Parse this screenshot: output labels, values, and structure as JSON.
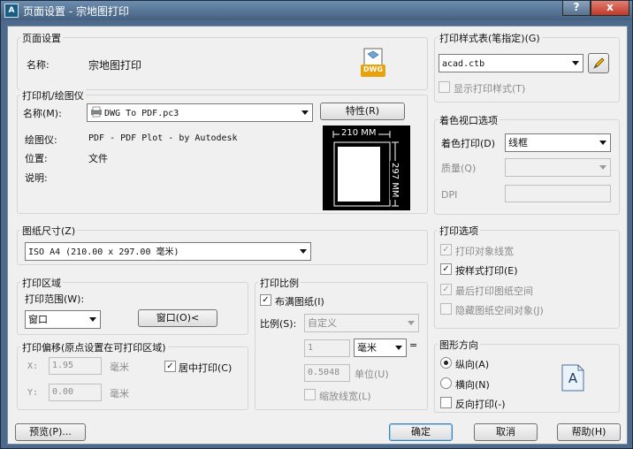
{
  "window": {
    "title": "页面设置 - 宗地图打印",
    "app_icon": "A",
    "help_label": "?",
    "close_label": "x"
  },
  "page_setup": {
    "group_label": "页面设置",
    "name_label": "名称:",
    "name_value": "宗地图打印",
    "dwg_icon_text": "DWG"
  },
  "printer": {
    "group_label": "打印机/绘图仪",
    "name_label": "名称(M):",
    "name_value": "DWG To PDF.pc3",
    "properties_button": "特性(R)",
    "plotter_label": "绘图仪:",
    "plotter_value": "PDF - PDF Plot - by Autodesk",
    "location_label": "位置:",
    "location_value": "文件",
    "description_label": "说明:",
    "preview_width_label": "210 MM",
    "preview_height_label": "297 MM"
  },
  "paper_size": {
    "group_label": "图纸尺寸(Z)",
    "value": "ISO A4 (210.00 x 297.00 毫米)"
  },
  "plot_area": {
    "group_label": "打印区域",
    "range_label": "打印范围(W):",
    "range_value": "窗口",
    "window_button": "窗口(O)<"
  },
  "plot_offset": {
    "group_label": "打印偏移(原点设置在可打印区域)",
    "x_label": "X:",
    "x_value": "1.95",
    "x_unit": "毫米",
    "y_label": "Y:",
    "y_value": "0.00",
    "y_unit": "毫米",
    "center_label": "居中打印(C)",
    "center_checked": true
  },
  "plot_scale": {
    "group_label": "打印比例",
    "fit_label": "布满图纸(I)",
    "fit_checked": true,
    "scale_label": "比例(S):",
    "scale_value": "自定义",
    "value1": "1",
    "unit_value": "毫米",
    "equals": "=",
    "value2": "0.5048",
    "unit2_label": "单位(U)",
    "scale_lineweights_label": "缩放线宽(L)"
  },
  "plot_style_table": {
    "group_label": "打印样式表(笔指定)(G)",
    "value": "acad.ctb",
    "display_label": "显示打印样式(T)",
    "display_checked": false
  },
  "shaded_viewport": {
    "group_label": "着色视口选项",
    "shade_label": "着色打印(D)",
    "shade_value": "线框",
    "quality_label": "质量(Q)",
    "dpi_label": "DPI"
  },
  "plot_options": {
    "group_label": "打印选项",
    "items": [
      {
        "label": "打印对象线宽",
        "checked": true,
        "enabled": false
      },
      {
        "label": "按样式打印(E)",
        "checked": true,
        "enabled": true
      },
      {
        "label": "最后打印图纸空间",
        "checked": true,
        "enabled": false
      },
      {
        "label": "隐藏图纸空间对象(J)",
        "checked": false,
        "enabled": false
      }
    ]
  },
  "orientation": {
    "group_label": "图形方向",
    "portrait_label": "纵向(A)",
    "landscape_label": "横向(N)",
    "upside_down_label": "反向打印(-)",
    "selected": "portrait",
    "icon_letter": "A"
  },
  "footer": {
    "preview_button": "预览(P)...",
    "ok_button": "确定",
    "cancel_button": "取消",
    "help_button": "帮助(H)"
  },
  "colors": {
    "title_bar": "#4d6a8c",
    "dialog_bg": "#f0f0f0",
    "close_button": "#c0392b",
    "dwg_badge": "#e8a20c",
    "preview_bg": "#000000"
  }
}
